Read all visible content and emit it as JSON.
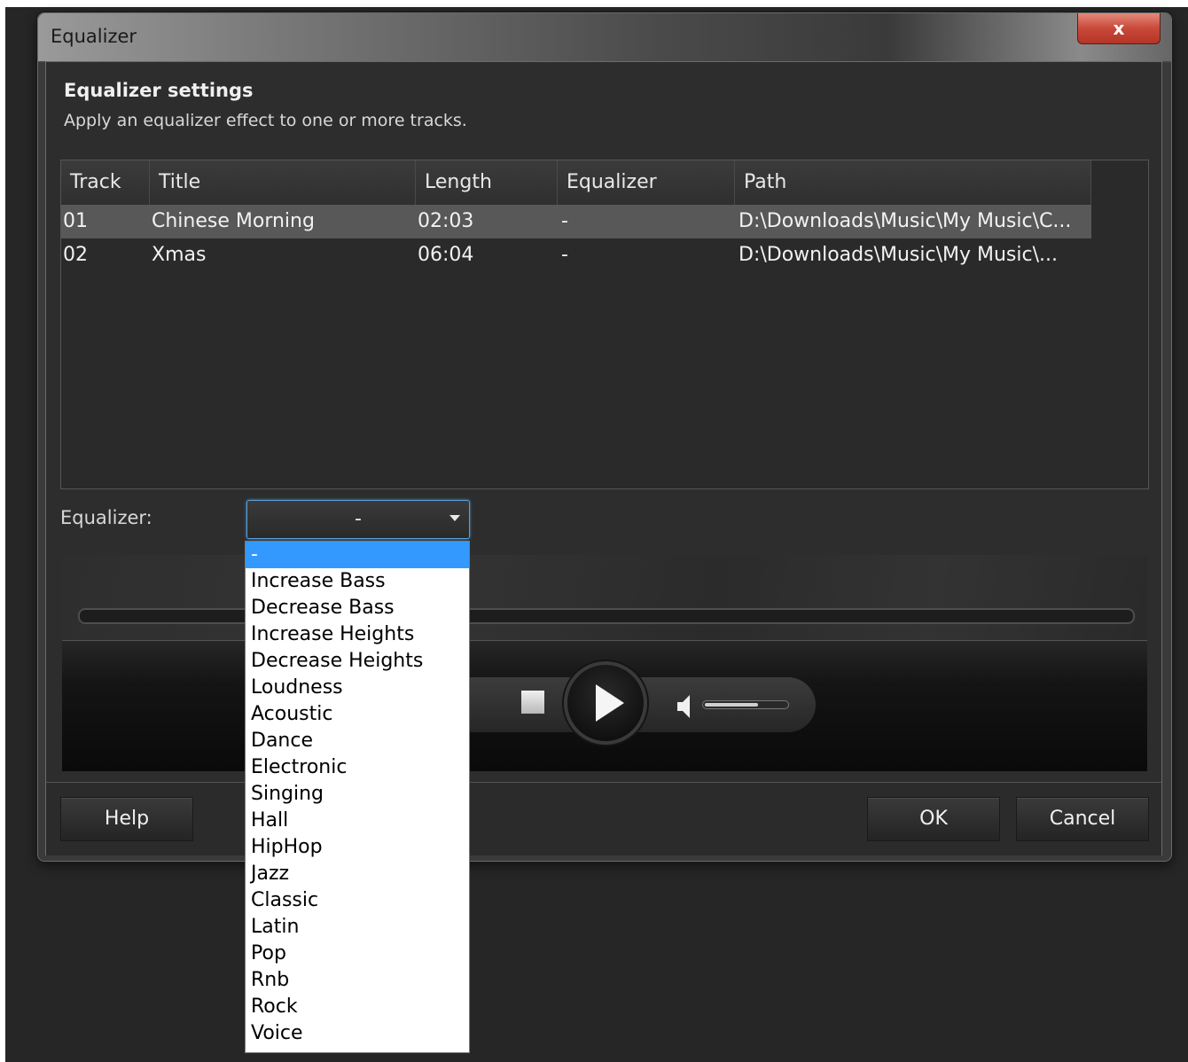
{
  "window": {
    "title": "Equalizer",
    "close_label": "x"
  },
  "header": {
    "title": "Equalizer settings",
    "description": "Apply an equalizer effect to one or more tracks."
  },
  "table": {
    "columns": [
      "Track",
      "Title",
      "Length",
      "Equalizer",
      "Path"
    ],
    "rows": [
      {
        "track": "01",
        "title": "Chinese Morning",
        "length": "02:03",
        "equalizer": "-",
        "path": "D:\\Downloads\\Music\\My Music\\C..."
      },
      {
        "track": "02",
        "title": "Xmas",
        "length": "06:04",
        "equalizer": "-",
        "path": "D:\\Downloads\\Music\\My Music\\..."
      }
    ],
    "selected_row": 0
  },
  "equalizer_select": {
    "label": "Equalizer:",
    "value": "-",
    "options": [
      "-",
      "Increase Bass",
      "Decrease Bass",
      "Increase Heights",
      "Decrease Heights",
      "Loudness",
      "Acoustic",
      "Dance",
      "Electronic",
      "Singing",
      "Hall",
      "HipHop",
      "Jazz",
      "Classic",
      "Latin",
      "Pop",
      "Rnb",
      "Rock",
      "Voice"
    ],
    "highlighted_index": 0
  },
  "player": {
    "icons": [
      "stop-icon",
      "play-icon",
      "volume-icon"
    ],
    "volume_level": 0.65
  },
  "buttons": {
    "help": "Help",
    "ok": "OK",
    "cancel": "Cancel"
  },
  "colors": {
    "accent": "#3399ff",
    "close": "#c9493a"
  }
}
